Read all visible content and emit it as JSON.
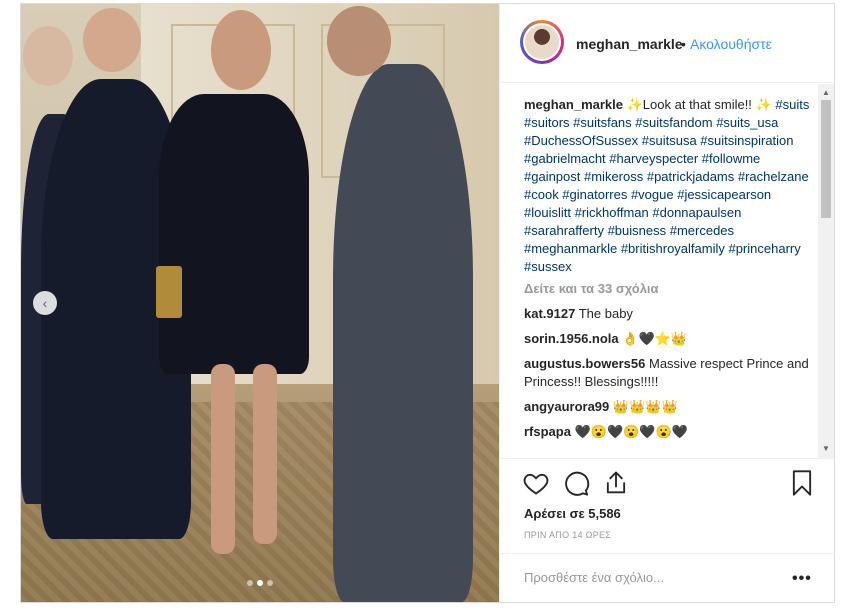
{
  "post": {
    "username": "meghan_markle",
    "separator": "•",
    "follow_label": "Ακολουθήστε",
    "caption_prefix": "✨Look at that smile!! ✨",
    "hashtags_text": "#suits #suitors #suitsfans #suitsfandom #suits_usa #DuchessOfSussex #suitsusa #suitsinspiration #gabrielmacht #harveyspecter #followme #gainpost #mikeross #patrickjadams #rachelzane #cook #ginatorres #vogue #jessicapearson #louislitt #rickhoffman #donnapaulsen #sarahrafferty #buisness #mercedes #meghanmarkle #britishroyalfamily #princeharry #sussex",
    "view_all_comments": "Δείτε και τα 33 σχόλια",
    "comments": [
      {
        "user": "kat.9127",
        "text": "The baby"
      },
      {
        "user": "sorin.1956.nola",
        "text": "👌🖤⭐👑"
      },
      {
        "user": "augustus.bowers56",
        "text": "Massive respect Prince and Princess!! Blessings!!!!!"
      },
      {
        "user": "angyaurora99",
        "text": "👑👑👑👑"
      },
      {
        "user": "rfspapa",
        "text": "🖤😮🖤😮🖤😮🖤"
      }
    ],
    "likes_text": "Αρέσει σε 5,586",
    "time_text": "ΠΡΙΝ ΑΠΟ 14 ΩΡΕΣ",
    "add_comment_placeholder": "Προσθέστε ένα σχόλιο...",
    "more_label": "•••",
    "carousel": {
      "count": 3,
      "active": 1
    }
  },
  "icons": {
    "like": "heart-icon",
    "comment": "comment-icon",
    "share": "share-icon",
    "save": "bookmark-icon",
    "prev": "chevron-left-icon"
  },
  "colors": {
    "link": "#3897f0",
    "hashtag": "#003569",
    "muted": "#999999",
    "border": "#efefef"
  }
}
